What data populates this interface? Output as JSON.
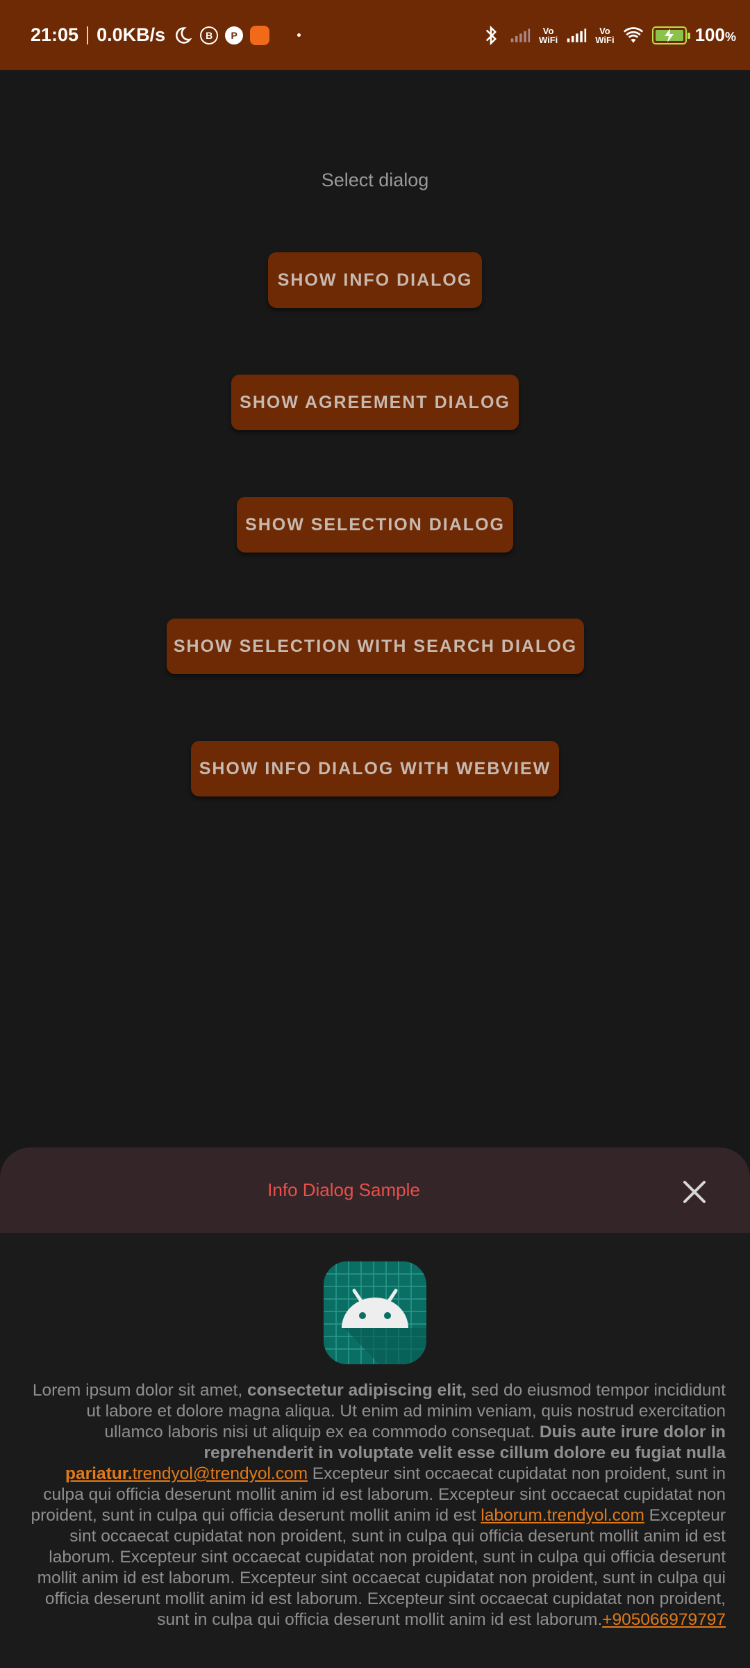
{
  "status_bar": {
    "time": "21:05",
    "network_speed": "0.0KB/s",
    "icons_left": [
      "moon-icon",
      "b-circle-icon",
      "p-circle-icon",
      "app-notification-icon"
    ],
    "icons_right": [
      "bluetooth-icon",
      "signal-icon",
      "vowifi-icon",
      "signal-icon",
      "vowifi-icon",
      "wifi-icon",
      "battery-charging-icon"
    ],
    "vowifi_top": "Vo",
    "vowifi_bottom": "WiFi",
    "b_label": "B",
    "p_label": "P",
    "battery_level": 1.0,
    "battery_percent": "100",
    "battery_percent_sign": "%"
  },
  "main": {
    "title": "Select dialog",
    "buttons": [
      {
        "label": "SHOW INFO DIALOG"
      },
      {
        "label": "SHOW AGREEMENT DIALOG"
      },
      {
        "label": "SHOW SELECTION DIALOG"
      },
      {
        "label": "SHOW SELECTION WITH SEARCH DIALOG"
      },
      {
        "label": "SHOW INFO DIALOG WITH WEBVIEW"
      }
    ]
  },
  "dialog": {
    "title": "Info Dialog Sample",
    "icon": "android-app-icon",
    "body": {
      "p1": "Lorem ipsum dolor sit amet, ",
      "b1": "consectetur adipiscing elit,",
      "p2": " sed do eiusmod tempor incididunt ut labore et dolore magna aliqua. Ut enim ad minim veniam, quis nostrud exercitation ullamco laboris nisi ut aliquip ex ea commodo consequat. ",
      "b2": "Duis aute irure dolor in reprehenderit in voluptate velit esse cillum dolore eu fugiat nulla ",
      "b2_link": "pariatur.",
      "email_link": "trendyol@trendyol.com",
      "p3": " Excepteur sint occaecat cupidatat non proident, sunt in culpa qui officia deserunt mollit anim id est laborum. Excepteur sint occaecat cupidatat non proident, sunt in culpa qui officia deserunt mollit anim id est ",
      "url_link": "laborum.trendyol.com",
      "p4": " Excepteur sint occaecat cupidatat non proident, sunt in culpa qui officia deserunt mollit anim id est laborum. Excepteur sint occaecat cupidatat non proident, sunt in culpa qui officia deserunt mollit anim id est laborum. Excepteur sint occaecat cupidatat non proident, sunt in culpa qui officia deserunt mollit anim id est laborum. Excepteur sint occaecat cupidatat non proident, sunt in culpa qui officia deserunt mollit anim id est laborum.",
      "phone_link": "+905066979797"
    }
  },
  "colors": {
    "accent": "#6e2a04",
    "link": "#e07a1a",
    "dialog_title": "#e8504a",
    "background": "#181818"
  }
}
